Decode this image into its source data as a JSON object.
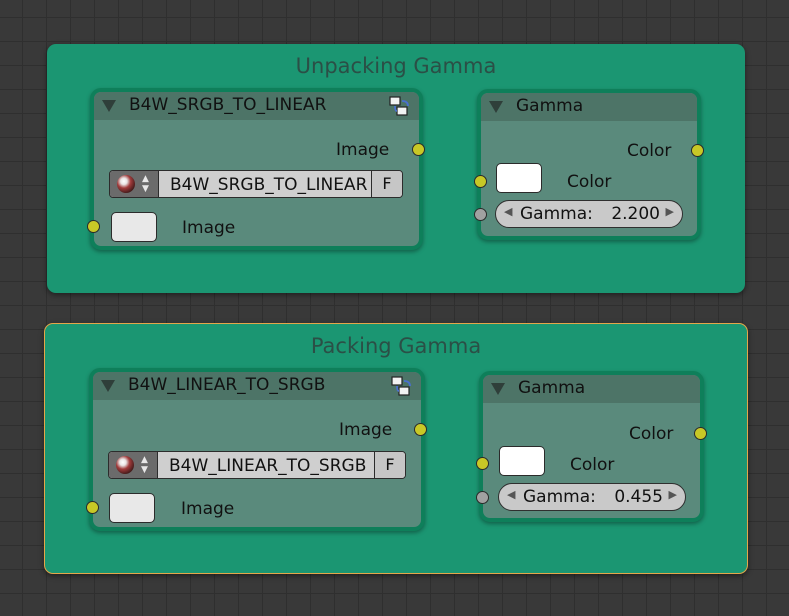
{
  "frames": [
    {
      "title": "Unpacking Gamma",
      "group_node": {
        "title": "B4W_SRGB_TO_LINEAR",
        "output_label": "Image",
        "selector": {
          "icon": "material-ball-icon",
          "name": "B4W_SRGB_TO_LINEAR",
          "fake_user": "F"
        },
        "input_label": "Image",
        "input_swatch_color": "#e8e8e8"
      },
      "gamma_node": {
        "title": "Gamma",
        "output_label": "Color",
        "color_label": "Color",
        "color_swatch_color": "#ffffff",
        "gamma_label": "Gamma:",
        "gamma_value": "2.200"
      }
    },
    {
      "title": "Packing Gamma",
      "group_node": {
        "title": "B4W_LINEAR_TO_SRGB",
        "output_label": "Image",
        "selector": {
          "icon": "material-ball-icon",
          "name": "B4W_LINEAR_TO_SRGB",
          "fake_user": "F"
        },
        "input_label": "Image",
        "input_swatch_color": "#e8e8e8"
      },
      "gamma_node": {
        "title": "Gamma",
        "output_label": "Color",
        "color_label": "Color",
        "color_swatch_color": "#ffffff",
        "gamma_label": "Gamma:",
        "gamma_value": "0.455"
      }
    }
  ],
  "colors": {
    "frame_bg": "#1b9672",
    "node_border": "#0e7f5a",
    "node_body": "#5a8a7c",
    "socket_color": "#c8c826",
    "socket_float": "#a1a1a1",
    "active_outline": "#e4a64a"
  }
}
